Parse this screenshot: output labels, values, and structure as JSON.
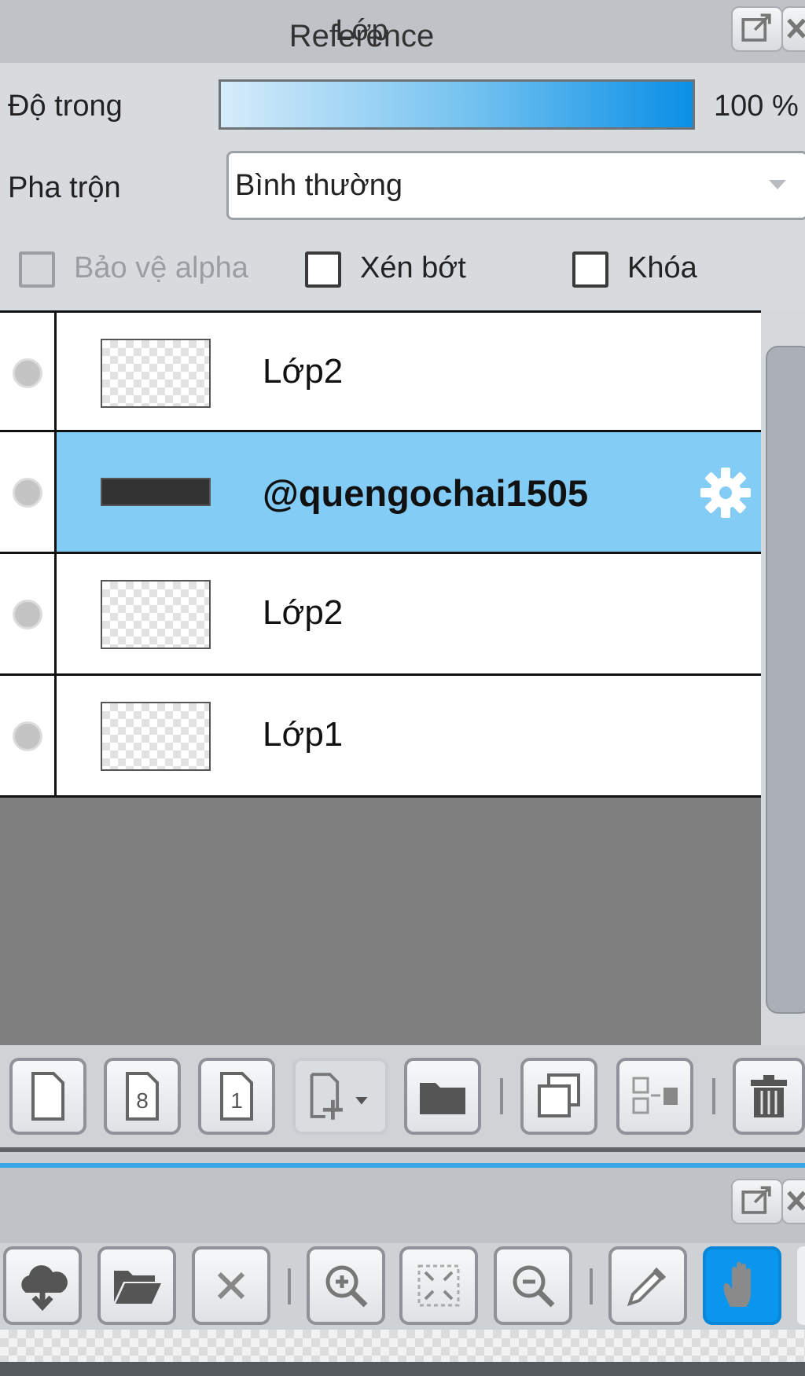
{
  "layer_panel": {
    "title": "Lớp",
    "opacity_label": "Độ trong",
    "opacity_value": "100 %",
    "opacity_level": 100,
    "blend_label": "Pha trộn",
    "blend_value": "Bình thường",
    "protect_alpha_label": "Bảo vệ alpha",
    "clip_label": "Xén bớt",
    "lock_label": "Khóa",
    "layers": [
      {
        "name": "Lớp2",
        "selected": false
      },
      {
        "name": "@quengochai1505",
        "selected": true
      },
      {
        "name": "Lớp2",
        "selected": false
      },
      {
        "name": "Lớp1",
        "selected": false
      }
    ]
  },
  "reference_panel": {
    "title": "Reference"
  },
  "colors": {
    "selected_row": "#82ccf5",
    "accent": "#0a96ee"
  }
}
